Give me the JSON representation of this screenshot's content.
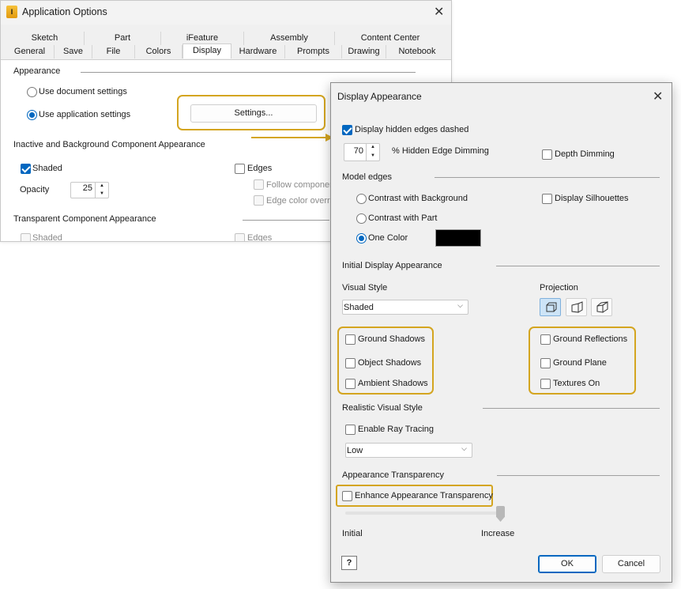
{
  "app_window": {
    "title": "Application Options",
    "tabs_row1": [
      "Sketch",
      "Part",
      "iFeature",
      "Assembly",
      "Content Center"
    ],
    "tabs_row2": [
      "General",
      "Save",
      "File",
      "Colors",
      "Display",
      "Hardware",
      "Prompts",
      "Drawing",
      "Notebook"
    ],
    "active_tab": "Display",
    "appearance": {
      "label": "Appearance",
      "use_document": "Use document settings",
      "use_application": "Use application settings",
      "settings_button": "Settings..."
    },
    "inactive": {
      "label": "Inactive and Background Component Appearance",
      "shaded": "Shaded",
      "edges": "Edges",
      "opacity_label": "Opacity",
      "opacity_value": "25",
      "follow_component": "Follow componen",
      "edge_color_override": "Edge color overric"
    },
    "transparent": {
      "label": "Transparent Component Appearance",
      "shaded": "Shaded",
      "edges": "Edges"
    }
  },
  "dialog": {
    "title": "Display Appearance",
    "hidden_edges_dashed": "Display hidden edges dashed",
    "hidden_edge_dimming_value": "70",
    "hidden_edge_dimming_label": "% Hidden Edge Dimming",
    "depth_dimming": "Depth Dimming",
    "model_edges": {
      "label": "Model edges",
      "contrast_background": "Contrast with Background",
      "contrast_part": "Contrast with Part",
      "one_color": "One Color",
      "display_silhouettes": "Display Silhouettes",
      "one_color_value": "#000000"
    },
    "initial_display": {
      "label": "Initial Display Appearance",
      "visual_style_label": "Visual Style",
      "visual_style_value": "Shaded",
      "projection_label": "Projection",
      "ground_shadows": "Ground Shadows",
      "object_shadows": "Object Shadows",
      "ambient_shadows": "Ambient Shadows",
      "ground_reflections": "Ground Reflections",
      "ground_plane": "Ground Plane",
      "textures_on": "Textures On"
    },
    "realistic": {
      "label": "Realistic Visual Style",
      "enable_ray_tracing": "Enable Ray Tracing",
      "quality_value": "Low"
    },
    "transparency": {
      "label": "Appearance Transparency",
      "enhance": "Enhance Appearance Transparency",
      "slider_left": "Initial",
      "slider_right": "Increase",
      "slider_level": 1.0
    },
    "help_glyph": "?",
    "ok": "OK",
    "cancel": "Cancel"
  },
  "colors": {
    "accent": "#0067c0",
    "highlight": "#d4a520",
    "arrow": "#d4a520"
  }
}
